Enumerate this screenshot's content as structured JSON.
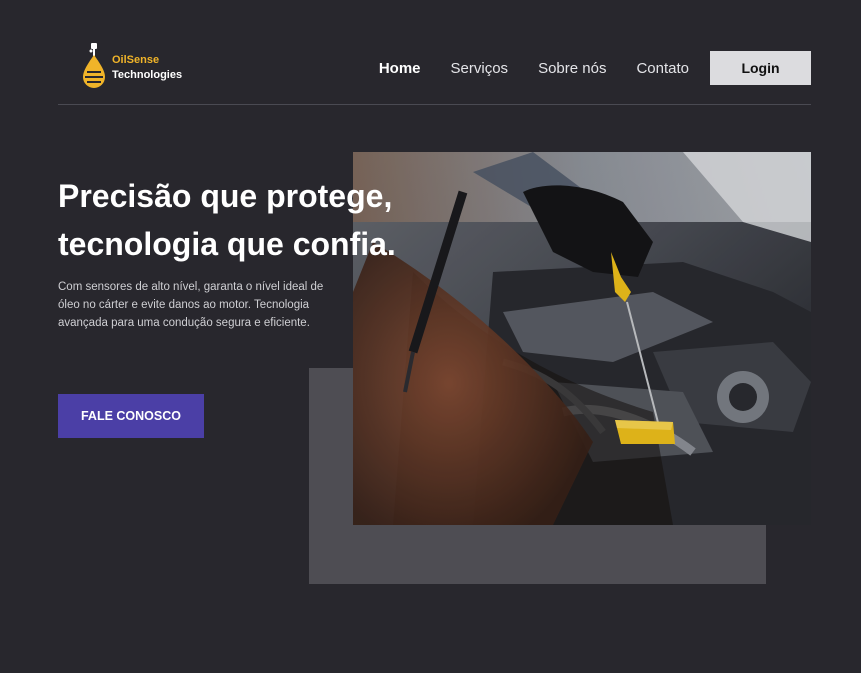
{
  "logo": {
    "line1": "OilSense",
    "line2": "Technologies",
    "icon": "oil-drop-icon",
    "accent": "#f0b429"
  },
  "nav": {
    "links": [
      {
        "label": "Home",
        "active": true
      },
      {
        "label": "Serviços",
        "active": false
      },
      {
        "label": "Sobre nós",
        "active": false
      },
      {
        "label": "Contato",
        "active": false
      }
    ],
    "login_label": "Login"
  },
  "hero": {
    "title_line1": "Precisão que protege,",
    "title_line2": "tecnologia que confia.",
    "description": "Com sensores de alto nível, garanta o nível ideal de óleo no cárter e evite danos ao motor. Tecnologia avançada para uma condução segura e eficiente.",
    "cta_label": "FALE CONOSCO",
    "image": "mechanic-checking-engine-oil-dipstick"
  },
  "colors": {
    "background": "#28272d",
    "cta": "#4b3fa6",
    "accent": "#f0b429",
    "block": "#4e4d53"
  }
}
